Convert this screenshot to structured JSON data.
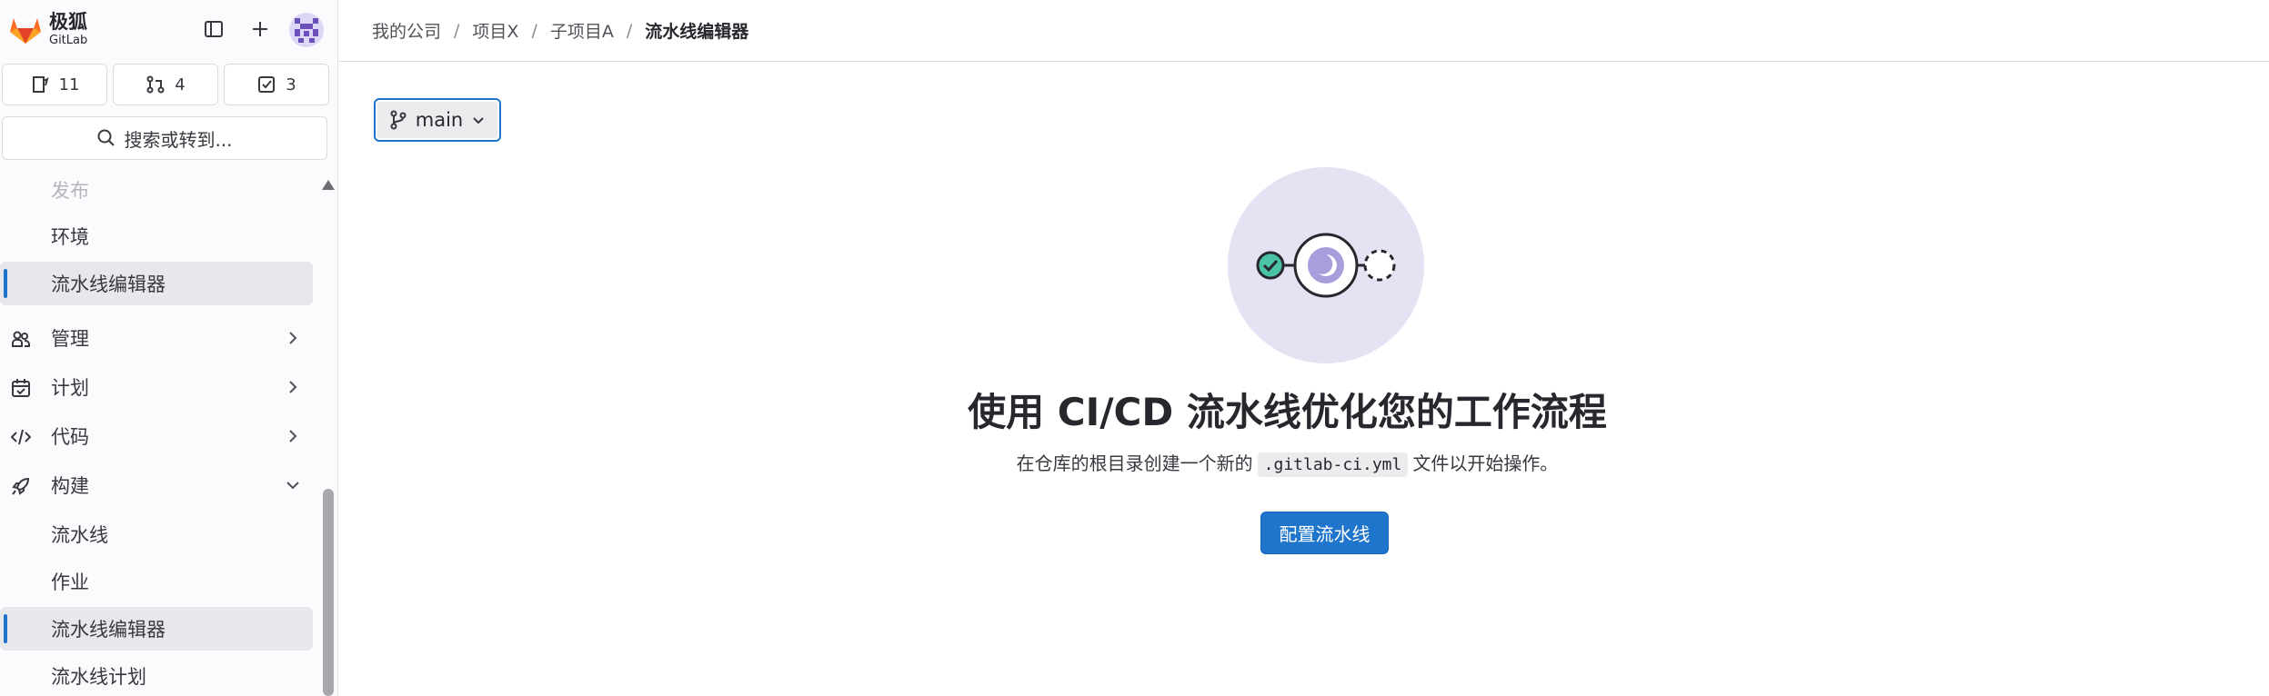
{
  "brand": {
    "name": "极狐",
    "sub": "GitLab"
  },
  "counts": {
    "issues": "11",
    "merge_requests": "4",
    "todos": "3"
  },
  "search": {
    "label": "搜索或转到..."
  },
  "sidebar": {
    "release_label": "发布",
    "environments_label": "环境",
    "pipeline_editor_top_label": "流水线编辑器",
    "sections": {
      "manage": "管理",
      "plan": "计划",
      "code": "代码",
      "build": "构建"
    },
    "build_items": {
      "pipelines": "流水线",
      "jobs": "作业",
      "pipeline_editor": "流水线编辑器",
      "pipeline_schedules": "流水线计划"
    }
  },
  "breadcrumb": [
    "我的公司",
    "项目X",
    "子项目A",
    "流水线编辑器"
  ],
  "branch": {
    "name": "main"
  },
  "empty_state": {
    "title": "使用 CI/CD 流水线优化您的工作流程",
    "desc_before": "在仓库的根目录创建一个新的",
    "code": ".gitlab-ci.yml",
    "desc_after": "文件以开始操作。",
    "button": "配置流水线"
  },
  "colors": {
    "accent": "#1f75cb",
    "illustration_bg": "#e5e2f4",
    "success": "#4ac2a6"
  }
}
